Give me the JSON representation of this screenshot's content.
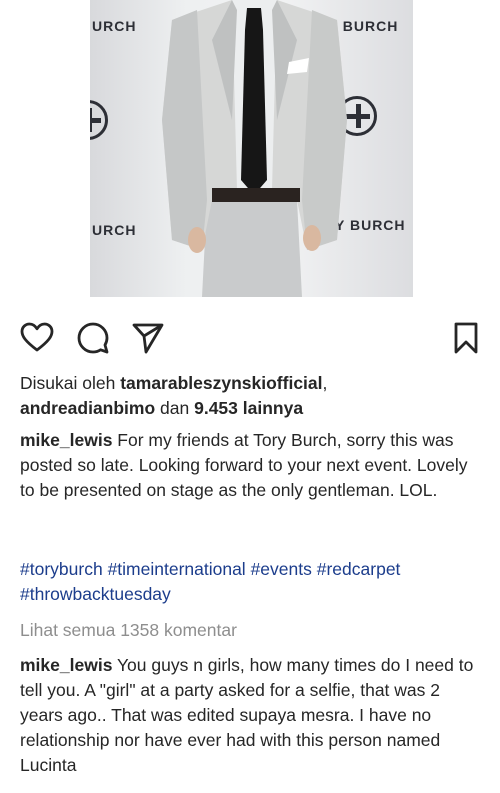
{
  "photo": {
    "backdrop": {
      "top_left": "URCH",
      "top_right": "TORY BURCH",
      "bottom_left": "URCH",
      "bottom_right": "Y BURCH"
    }
  },
  "actions": {
    "like_icon": "heart-outline-icon",
    "comment_icon": "comment-bubble-icon",
    "share_icon": "paper-plane-icon",
    "save_icon": "bookmark-icon"
  },
  "likes": {
    "prefix": "Disukai oleh ",
    "user1": "tamarableszynskiofficial",
    "sep": ",",
    "user2": "andreadianbimo",
    "middle": " dan ",
    "others": "9.453 lainnya"
  },
  "caption": {
    "username": "mike_lewis",
    "text": "For my friends at Tory Burch, sorry this was posted so late. Looking forward to your next event. Lovely to be presented on stage as the only gentleman. LOL."
  },
  "hashtags": [
    "#toryburch",
    "#timeinternational",
    "#events",
    "#redcarpet",
    "#throwbacktuesday"
  ],
  "view_comments": "Lihat semua 1358 komentar",
  "comment": {
    "username": "mike_lewis",
    "text": "You guys n girls, how many times do I need to tell you. A \"girl\" at a party asked for a selfie, that was 2 years ago.. That was edited supaya mesra. I have no relationship nor have ever had with this person named Lucinta"
  }
}
